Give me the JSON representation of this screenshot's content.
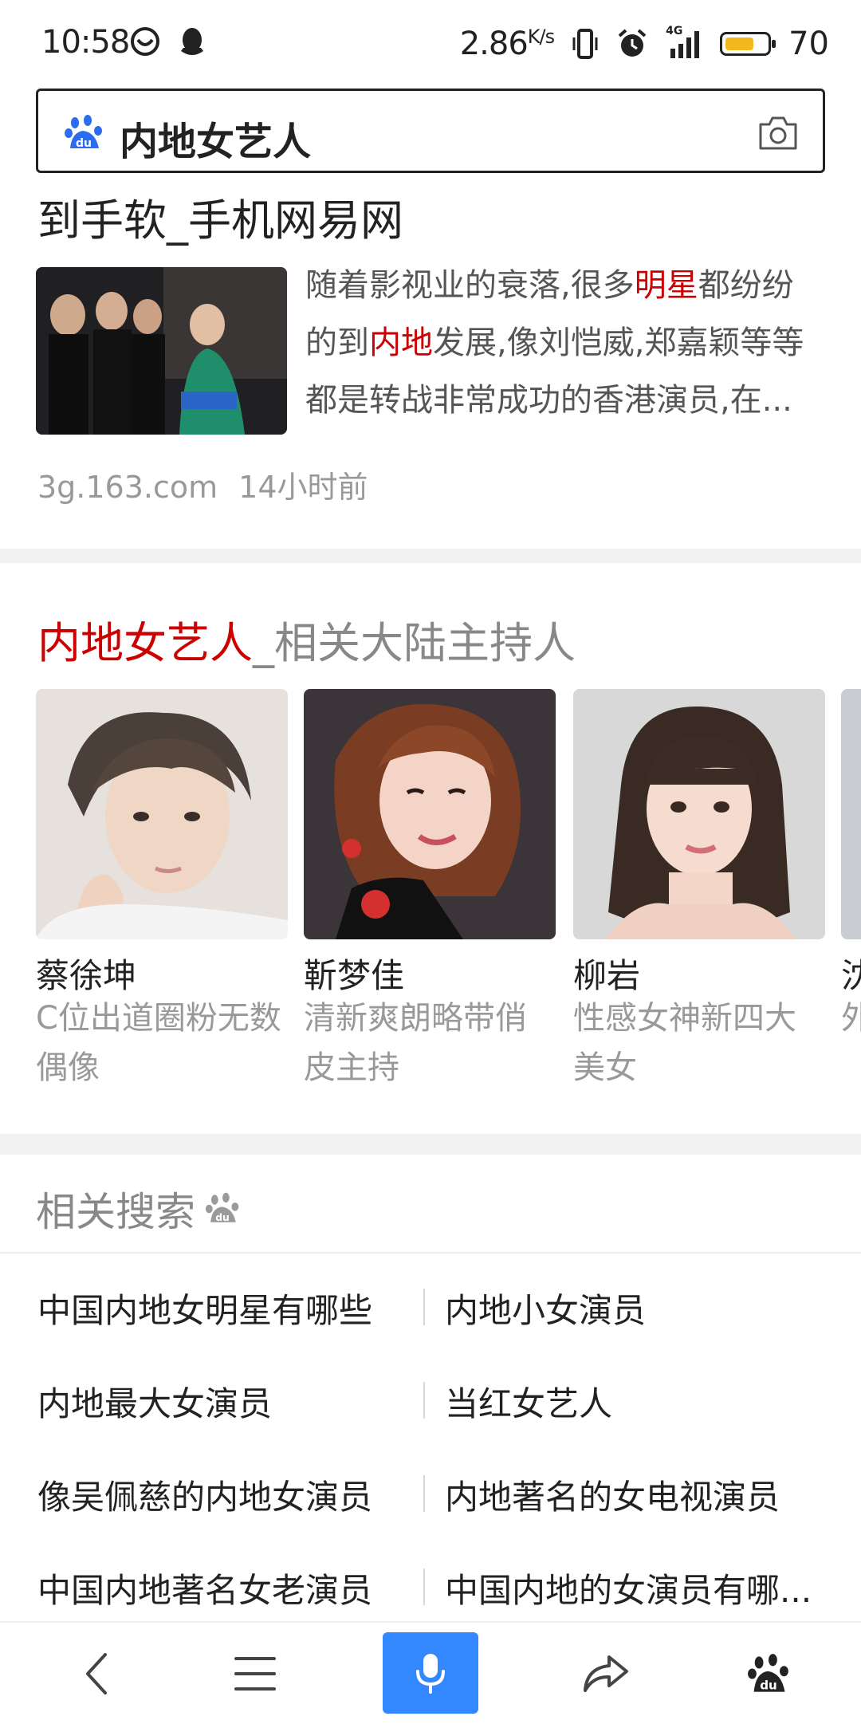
{
  "status_bar": {
    "time": "10:58",
    "speed_value": "2.86",
    "speed_unit": "K/s",
    "network": "4G",
    "battery_level": "70",
    "battery_fraction": 0.7,
    "battery_color": "#f4b81e"
  },
  "search": {
    "query": "内地女艺人"
  },
  "result": {
    "title": "到手软_手机网易网",
    "snippet_1": "随着影视业的衰落,很多",
    "snippet_hl_1": "明星",
    "snippet_2": "都纷纷的到",
    "snippet_hl_2": "内地",
    "snippet_3": "发展,像刘恺威,郑嘉颖等等都是转战非常成功的香港演员,在...",
    "source": "3g.163.com",
    "time": "14小时前"
  },
  "related_hosts": {
    "title_highlight": "内地女艺人",
    "title_rest": "_相关大陆主持人",
    "cards": [
      {
        "name": "蔡徐坤",
        "desc": "C位出道圈粉无数偶像"
      },
      {
        "name": "靳梦佳",
        "desc": "清新爽朗略带俏皮主持"
      },
      {
        "name": "柳岩",
        "desc": "性感女神新四大美女"
      },
      {
        "name": "沈",
        "desc": "外感"
      }
    ]
  },
  "related_searches": {
    "title": "相关搜索",
    "items": [
      "中国内地女明星有哪些",
      "内地小女演员",
      "内地最大女演员",
      "当红女艺人",
      "像吴佩慈的内地女演员",
      "内地著名的女电视演员",
      "中国内地著名女老演员",
      "中国内地的女演员有哪..."
    ]
  },
  "bottom_nav": {
    "icons": [
      "back-icon",
      "menu-icon",
      "microphone-icon",
      "share-icon",
      "baidu-icon"
    ]
  },
  "colors": {
    "highlight": "#cc0000",
    "accent": "#3388ff"
  }
}
